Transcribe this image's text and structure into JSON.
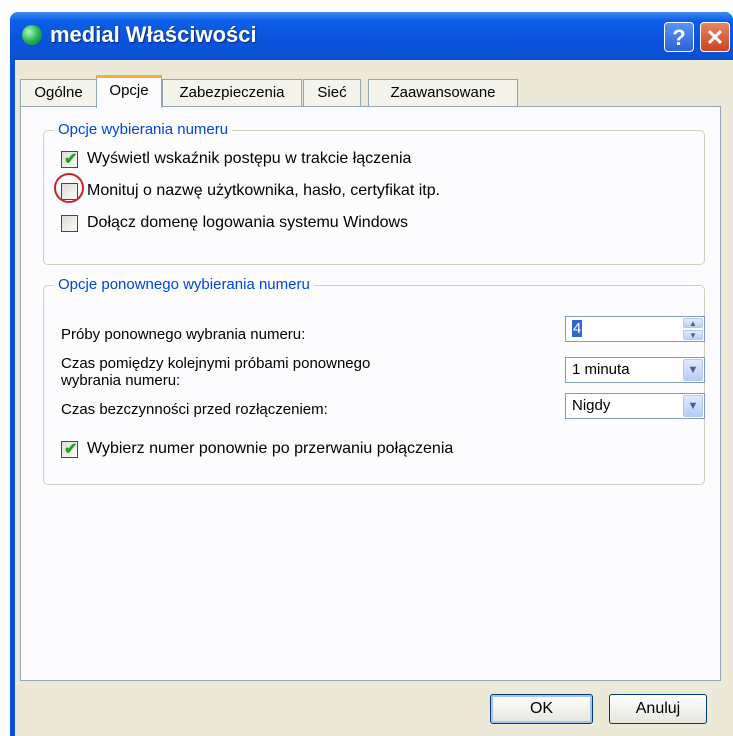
{
  "window": {
    "title": "medial Właściwości",
    "help_label": "?",
    "close_label": "✕"
  },
  "tabs": [
    {
      "label": "Ogólne"
    },
    {
      "label": "Opcje"
    },
    {
      "label": "Zabezpieczenia"
    },
    {
      "label": "Sieć"
    },
    {
      "label": "Zaawansowane"
    }
  ],
  "dialing_group": {
    "legend": "Opcje wybierania numeru",
    "options": [
      {
        "label": "Wyświetl wskaźnik postępu w trakcie łączenia",
        "checked": true
      },
      {
        "label": "Monituj o nazwę użytkownika, hasło, certyfikat itp.",
        "checked": false
      },
      {
        "label": "Dołącz domenę logowania systemu Windows",
        "checked": false
      }
    ]
  },
  "redial_group": {
    "legend": "Opcje ponownego wybierania numeru",
    "attempts_label": "Próby ponownego wybrania numeru:",
    "attempts_value": "4",
    "interval_label": "Czas pomiędzy kolejnymi próbami ponownego wybrania numeru:",
    "interval_value": "1 minuta",
    "idle_label": "Czas bezczynności przed rozłączeniem:",
    "idle_value": "Nigdy",
    "redial_option": {
      "label": "Wybierz numer ponownie po przerwaniu połączenia",
      "checked": true
    }
  },
  "buttons": {
    "ok": "OK",
    "cancel": "Anuluj"
  },
  "icons": {
    "title": "network-connection-icon",
    "check": "✔",
    "spin_up": "▲",
    "spin_down": "▼",
    "dropdown": "▼"
  },
  "colors": {
    "legend_text": "#0046d5",
    "annotation_circle": "#d0202a",
    "checkmark": "#21a121"
  }
}
